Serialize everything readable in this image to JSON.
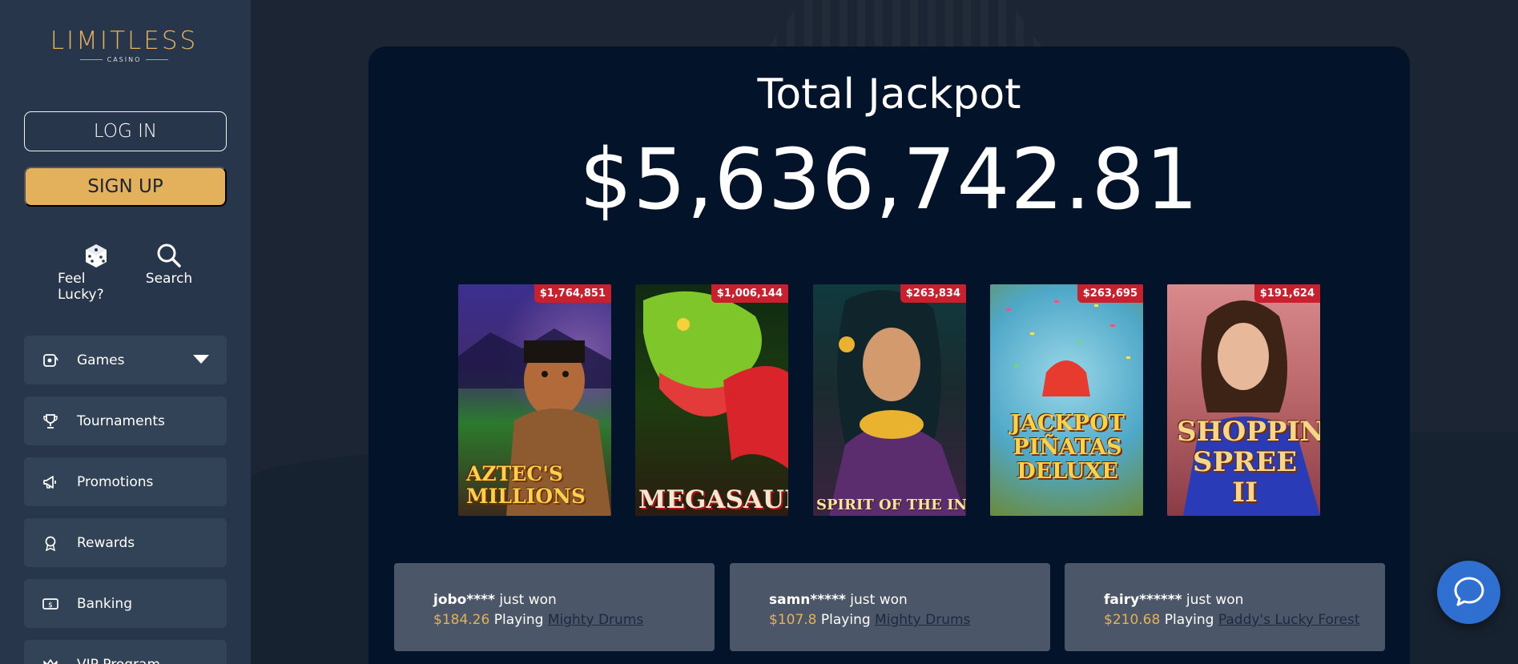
{
  "sidebar": {
    "logo": {
      "word": "LIMITLESS",
      "sub": "CASINO"
    },
    "login_label": "LOG IN",
    "signup_label": "SIGN UP",
    "quick": [
      {
        "label": "Feel Lucky?",
        "icon": "dice-icon"
      },
      {
        "label": "Search",
        "icon": "search-icon"
      }
    ],
    "nav": [
      {
        "label": "Games",
        "icon": "slot-icon"
      },
      {
        "label": "Tournaments",
        "icon": "trophy-icon"
      },
      {
        "label": "Promotions",
        "icon": "megaphone-icon"
      },
      {
        "label": "Rewards",
        "icon": "award-icon"
      },
      {
        "label": "Banking",
        "icon": "cash-icon"
      },
      {
        "label": "VIP Program",
        "icon": "crown-icon"
      }
    ]
  },
  "jackpot": {
    "title": "Total Jackpot",
    "amount": "$5,636,742.81"
  },
  "games": [
    {
      "name": "AZTEC'S MILLIONS",
      "jackpot": "$1,764,851"
    },
    {
      "name": "MEGASAUR",
      "jackpot": "$1,006,144"
    },
    {
      "name": "SPIRIT OF THE INCA",
      "jackpot": "$263,834"
    },
    {
      "name": "JACKPOT PIÑATAS DELUXE",
      "jackpot": "$263,695"
    },
    {
      "name": "SHOPPING SPREE II",
      "jackpot": "$191,624"
    }
  ],
  "wins": [
    {
      "user": "jobo****",
      "text": "just won",
      "amount": "$184.26",
      "playing": "Playing",
      "game": "Mighty Drums"
    },
    {
      "user": "samn*****",
      "text": "just won",
      "amount": "$107.8",
      "playing": "Playing",
      "game": "Mighty Drums"
    },
    {
      "user": "fairy******",
      "text": "just won",
      "amount": "$210.68",
      "playing": "Playing",
      "game": "Paddy's Lucky Forest"
    }
  ],
  "colors": {
    "accent_gold": "#e3b15c",
    "sidebar_bg": "#27364a",
    "panel_bg": "#03132a",
    "badge_red": "#c8202d",
    "chat_blue": "#2e6fd0"
  }
}
